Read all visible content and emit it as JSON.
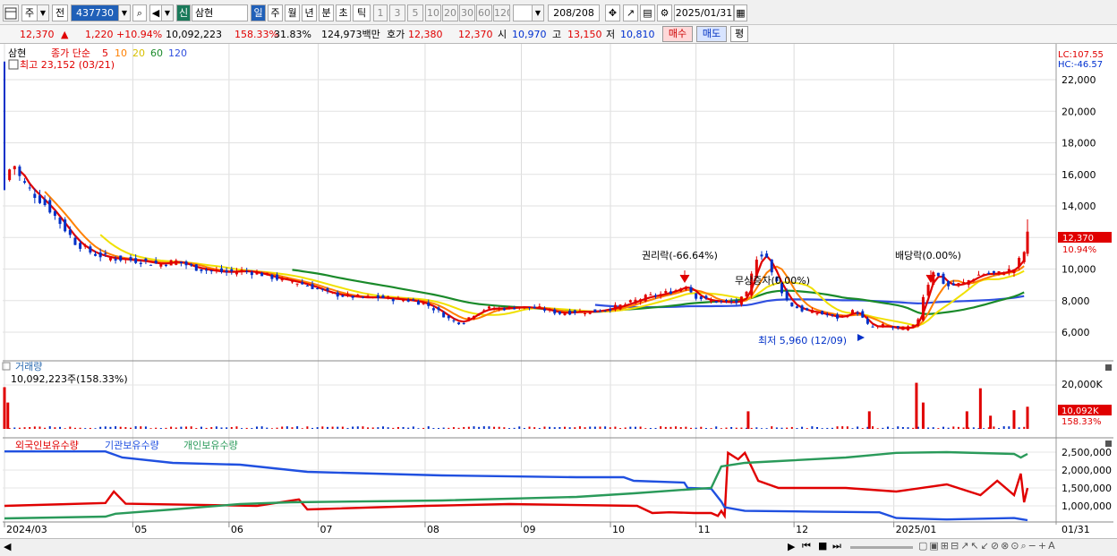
{
  "toolbar": {
    "market": "주",
    "prev_btn": "전",
    "code": "437730",
    "badge": "신",
    "name": "삼현",
    "periods": [
      "일",
      "주",
      "월",
      "년",
      "분",
      "초",
      "틱"
    ],
    "numbers": [
      "1",
      "3",
      "5",
      "10",
      "20",
      "30",
      "60",
      "120"
    ],
    "count": "208",
    "count_total": "/208",
    "date": "2025/01/31"
  },
  "quote": {
    "price": "12,370",
    "arrow": "▲",
    "change": "1,220",
    "change_pct": "+10.94%",
    "volume": "10,092,223",
    "volume_pct": "158.33%",
    "turnover": "31.83%",
    "amount": "124,973백만",
    "hoga_label": "호가",
    "ask": "12,380",
    "bid": "12,370",
    "open_label": "시",
    "open": "10,970",
    "high_label": "고",
    "high": "13,150",
    "low_label": "저",
    "low": "10,810",
    "buy_btn": "매수",
    "sell_btn": "매도",
    "avg_btn": "평"
  },
  "price_panel": {
    "legend_name": "삼현",
    "legend_ma_label": "종가 단순",
    "ma_periods": [
      "5",
      "10",
      "20",
      "60",
      "120"
    ],
    "ma_colors": [
      "#e00000",
      "#ff8000",
      "#f0e000",
      "#1a8a2a",
      "#3050e0"
    ],
    "max_label": "최고 23,152 (03/21)",
    "min_label": "최저 5,960 (12/09)",
    "lc": "LC:107.55",
    "hc": "HC:-46.57",
    "y_ticks": [
      "22,000",
      "20,000",
      "18,000",
      "16,000",
      "14,000",
      "12,000",
      "10,000",
      "8,000",
      "6,000"
    ],
    "current_price_tag": "12,370",
    "current_pct_tag": "10.94%",
    "annotations": [
      "권리락(-66.64%)",
      "무상증자(0.00%)",
      "배당락(0.00%)"
    ]
  },
  "volume_panel": {
    "title": "거래량",
    "value_label": "10,092,223주(158.33%)",
    "y_tick": "20,000K",
    "current_tag": "10,092K",
    "pct_tag": "158.33%"
  },
  "holdings_panel": {
    "series": [
      "외국인보유수량",
      "기관보유수량",
      "개인보유수량"
    ],
    "series_colors": [
      "#e00000",
      "#2050e0",
      "#2a9a5a"
    ],
    "y_ticks": [
      "2,500,000",
      "2,000,000",
      "1,500,000",
      "1,000,000"
    ]
  },
  "x_axis": {
    "labels": [
      "2024/03",
      "05",
      "06",
      "07",
      "08",
      "09",
      "10",
      "11",
      "12",
      "2025/01"
    ],
    "right_label": "01/31"
  },
  "colors": {
    "up": "#e00000",
    "down": "#0030c8",
    "grid": "#dcdcdc"
  },
  "chart_data": {
    "type": "candlestick",
    "title": "삼현",
    "x": [
      "2024/03",
      "05",
      "06",
      "07",
      "08",
      "09",
      "10",
      "11",
      "12",
      "2025/01"
    ],
    "ylim": [
      5000,
      23500
    ],
    "close_path": [
      [
        0,
        15600
      ],
      [
        5,
        16800
      ],
      [
        10,
        15600
      ],
      [
        18,
        14700
      ],
      [
        26,
        13900
      ],
      [
        34,
        12800
      ],
      [
        42,
        11700
      ],
      [
        52,
        11000
      ],
      [
        62,
        10700
      ],
      [
        72,
        10600
      ],
      [
        82,
        10500
      ],
      [
        92,
        10300
      ],
      [
        102,
        10500
      ],
      [
        112,
        10100
      ],
      [
        122,
        9900
      ],
      [
        132,
        9800
      ],
      [
        142,
        9900
      ],
      [
        152,
        9700
      ],
      [
        162,
        9400
      ],
      [
        172,
        9200
      ],
      [
        182,
        8900
      ],
      [
        192,
        8500
      ],
      [
        202,
        8300
      ],
      [
        212,
        8200
      ],
      [
        222,
        8200
      ],
      [
        232,
        8100
      ],
      [
        242,
        8000
      ],
      [
        250,
        7800
      ],
      [
        258,
        7300
      ],
      [
        266,
        6700
      ],
      [
        272,
        6600
      ],
      [
        278,
        7100
      ],
      [
        286,
        7500
      ],
      [
        296,
        7500
      ],
      [
        306,
        7600
      ],
      [
        318,
        7500
      ],
      [
        330,
        7200
      ],
      [
        340,
        7300
      ],
      [
        350,
        7300
      ],
      [
        360,
        7500
      ],
      [
        370,
        7800
      ],
      [
        380,
        8200
      ],
      [
        390,
        8400
      ],
      [
        400,
        8700
      ],
      [
        405,
        9000
      ],
      [
        410,
        8300
      ],
      [
        418,
        8000
      ],
      [
        428,
        7900
      ],
      [
        436,
        7900
      ],
      [
        442,
        8500
      ],
      [
        446,
        10700
      ],
      [
        452,
        11100
      ],
      [
        456,
        9700
      ],
      [
        460,
        9000
      ],
      [
        466,
        7800
      ],
      [
        474,
        7400
      ],
      [
        484,
        7200
      ],
      [
        496,
        6900
      ],
      [
        506,
        7400
      ],
      [
        514,
        6300
      ],
      [
        522,
        6400
      ],
      [
        532,
        6200
      ],
      [
        542,
        6400
      ],
      [
        546,
        8300
      ],
      [
        552,
        9900
      ],
      [
        560,
        8900
      ],
      [
        570,
        9100
      ],
      [
        580,
        9700
      ],
      [
        590,
        9700
      ],
      [
        600,
        10000
      ],
      [
        606,
        11100
      ],
      [
        608,
        12370
      ]
    ],
    "annotations": [
      {
        "label": "권리락(-66.64%)",
        "x_index": 400
      },
      {
        "label": "무상증자(0.00%)",
        "x_index": 442
      },
      {
        "label": "배당락(0.00%)",
        "x_index": 546
      }
    ],
    "max": {
      "value": 23152,
      "date": "03/21"
    },
    "min": {
      "value": 5960,
      "date": "12/09"
    },
    "volume": {
      "current": 10092223,
      "pct": 158.33,
      "spikes": [
        [
          0,
          19000
        ],
        [
          2,
          12000
        ],
        [
          442,
          8000
        ],
        [
          514,
          8000
        ],
        [
          542,
          21000
        ],
        [
          546,
          12000
        ],
        [
          572,
          8000
        ],
        [
          580,
          18500
        ],
        [
          586,
          6000
        ],
        [
          600,
          8500
        ],
        [
          608,
          10092
        ]
      ]
    },
    "holdings": {
      "foreign": [
        [
          0,
          1000000
        ],
        [
          60,
          1080000
        ],
        [
          65,
          1400000
        ],
        [
          72,
          1060000
        ],
        [
          150,
          1000000
        ],
        [
          175,
          1180000
        ],
        [
          180,
          900000
        ],
        [
          250,
          1000000
        ],
        [
          300,
          1050000
        ],
        [
          376,
          1000000
        ],
        [
          385,
          800000
        ],
        [
          395,
          820000
        ],
        [
          410,
          800000
        ],
        [
          420,
          800000
        ],
        [
          424,
          720000
        ],
        [
          426,
          860000
        ],
        [
          428,
          720000
        ],
        [
          430,
          2480000
        ],
        [
          436,
          2300000
        ],
        [
          440,
          2480000
        ],
        [
          448,
          1700000
        ],
        [
          460,
          1500000
        ],
        [
          500,
          1500000
        ],
        [
          530,
          1400000
        ],
        [
          560,
          1600000
        ],
        [
          580,
          1300000
        ],
        [
          590,
          1700000
        ],
        [
          600,
          1300000
        ],
        [
          604,
          1900000
        ],
        [
          606,
          1100000
        ],
        [
          608,
          1500000
        ]
      ],
      "institution": [
        [
          0,
          2520000
        ],
        [
          60,
          2520000
        ],
        [
          70,
          2350000
        ],
        [
          100,
          2200000
        ],
        [
          140,
          2150000
        ],
        [
          180,
          1950000
        ],
        [
          260,
          1850000
        ],
        [
          340,
          1800000
        ],
        [
          368,
          1800000
        ],
        [
          374,
          1700000
        ],
        [
          404,
          1650000
        ],
        [
          406,
          1500000
        ],
        [
          420,
          1480000
        ],
        [
          426,
          1120000
        ],
        [
          428,
          960000
        ],
        [
          440,
          860000
        ],
        [
          480,
          840000
        ],
        [
          520,
          820000
        ],
        [
          530,
          660000
        ],
        [
          560,
          620000
        ],
        [
          600,
          660000
        ],
        [
          608,
          600000
        ]
      ],
      "individual": [
        [
          0,
          650000
        ],
        [
          60,
          700000
        ],
        [
          66,
          780000
        ],
        [
          100,
          900000
        ],
        [
          140,
          1050000
        ],
        [
          170,
          1100000
        ],
        [
          260,
          1150000
        ],
        [
          340,
          1250000
        ],
        [
          374,
          1350000
        ],
        [
          404,
          1450000
        ],
        [
          420,
          1500000
        ],
        [
          426,
          2100000
        ],
        [
          440,
          2200000
        ],
        [
          460,
          2250000
        ],
        [
          500,
          2350000
        ],
        [
          530,
          2480000
        ],
        [
          560,
          2500000
        ],
        [
          600,
          2450000
        ],
        [
          604,
          2350000
        ],
        [
          608,
          2450000
        ]
      ]
    }
  }
}
